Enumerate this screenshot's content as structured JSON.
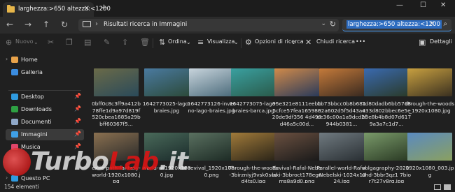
{
  "window": {
    "tab_title": "larghezza:>650 altezza:<1200",
    "controls": {
      "minimize": "—",
      "maximize": "☐",
      "close": "✕"
    }
  },
  "nav": {
    "back": "←",
    "forward": "→",
    "up": "↑",
    "refresh": "↻",
    "breadcrumb": "Risultati ricerca in Immagini",
    "search_query": "larghezza:>650 altezza:<1200"
  },
  "commands": {
    "new": "Nuovo",
    "sort": "Ordina",
    "view": "Visualizza",
    "search_options": "Opzioni di ricerca",
    "close_search": "Chiudi ricerca",
    "more": "•••",
    "details": "Dettagli"
  },
  "sidebar": {
    "items": [
      {
        "label": "Home",
        "color": "#e8a24a"
      },
      {
        "label": "Galleria",
        "color": "#3b8de0"
      },
      {
        "label": "Desktop",
        "color": "#2f9be0"
      },
      {
        "label": "Downloads",
        "color": "#2ea043"
      },
      {
        "label": "Documenti",
        "color": "#8fa8c8"
      },
      {
        "label": "Immagini",
        "color": "#3fa0e6"
      },
      {
        "label": "Musica",
        "color": "#e0466a"
      },
      {
        "label": "Questo PC",
        "color": "#2f9be0"
      }
    ]
  },
  "files": [
    {
      "name": "0bff0c8c3ff9a412b78ffe1d9a97d819f520cbea1685a29bbff60367f5...",
      "c1": "#6a6a48",
      "c2": "#2a4a5a"
    },
    {
      "name": "1642773025-lago-braies.jpg",
      "c1": "#4a7aa0",
      "c2": "#2c4a3a"
    },
    {
      "name": "1642773126-inverno-lago-braies.jpg",
      "c1": "#c8d4dc",
      "c2": "#4a6a7a"
    },
    {
      "name": "1642773075-lago-braies-barca.jpg",
      "c1": "#3aa0a0",
      "c2": "#2a5a4a"
    },
    {
      "name": "95e321e8111eebb5cfce57fea16598e20de9df356 4d498d46a5c00d...",
      "c1": "#d08a4a",
      "c2": "#2a3a5a"
    },
    {
      "name": "1b73bbcc0b8b68102a602d5f5d43a4ee36c00a1a9dcd2f944b0381...",
      "c1": "#c47a3a",
      "c2": "#3a2a20"
    },
    {
      "name": "7d80dadb6bb57d8e33d802bbec6e5eb3e8b4b8d07d6179a3a7c1d7...",
      "c1": "#3a6ab0",
      "c2": "#2a3a2a"
    },
    {
      "name": "through-the-woods_1920x1080.jpg",
      "c1": "#c8a040",
      "c2": "#3a3020"
    },
    {
      "name": "exile-path-fantasy-world-1920x1080.jpg",
      "c1": "#8a7050",
      "c2": "#2a2a2a"
    },
    {
      "name": "world-w-1920x1080.jpg",
      "c1": "#4a6a5a",
      "c2": "#1a2a2a"
    },
    {
      "name": "revival_1920x1080.png",
      "c1": "#5a7060",
      "c2": "#1c2a24"
    },
    {
      "name": "Through-the-woods-3birzniyj9vsk0suod4ts0.jpg",
      "c1": "#a07a3a",
      "c2": "#2a2418"
    },
    {
      "name": "Revival-Rafal-Nebelski-3bbroct178egnms8a9d0.png",
      "c1": "#6a5040",
      "c2": "#1a1a1a"
    },
    {
      "name": "Parallel-world-Rafal-Nebelski-1024x1024.jpg",
      "c1": "#707a80",
      "c2": "#2a3034"
    },
    {
      "name": "volgagraphy-2020-uhd-3bbr3qz1 7bior7t27y8rg.jpg",
      "c1": "#7a9a6a",
      "c2": "#2a3a24"
    },
    {
      "name": "1920x1080_003.jpg",
      "c1": "#5a8ac0",
      "c2": "#8aa060"
    }
  ],
  "status": {
    "count": "154 elementi"
  },
  "watermark": {
    "brand": "TurboLab.it"
  }
}
